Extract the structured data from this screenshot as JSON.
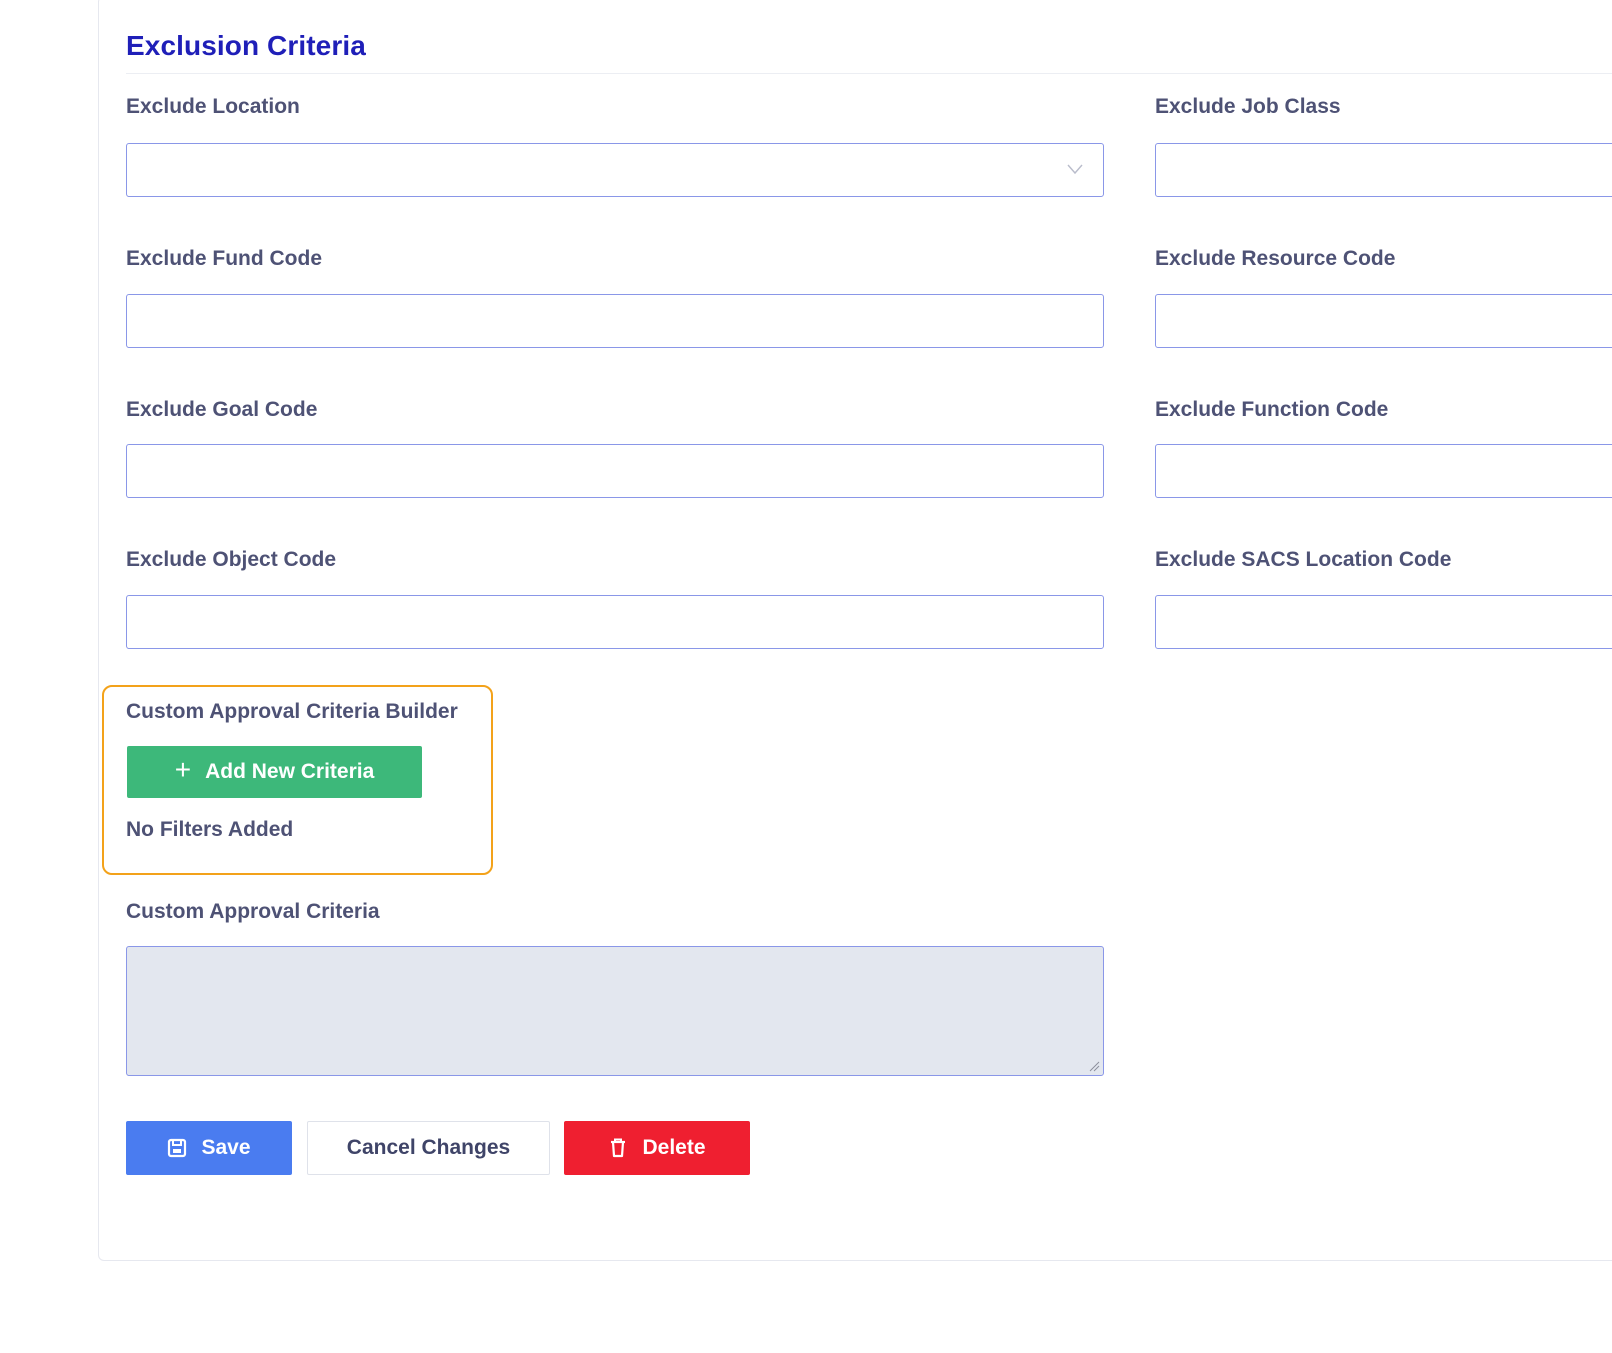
{
  "section": {
    "title": "Exclusion Criteria"
  },
  "fields": {
    "exclude_location": {
      "label": "Exclude Location",
      "value": ""
    },
    "exclude_job_class": {
      "label": "Exclude Job Class",
      "value": ""
    },
    "exclude_fund_code": {
      "label": "Exclude Fund Code",
      "value": ""
    },
    "exclude_resource_code": {
      "label": "Exclude Resource Code",
      "value": ""
    },
    "exclude_goal_code": {
      "label": "Exclude Goal Code",
      "value": ""
    },
    "exclude_function_code": {
      "label": "Exclude Function Code",
      "value": ""
    },
    "exclude_object_code": {
      "label": "Exclude Object Code",
      "value": ""
    },
    "exclude_sacs_location_code": {
      "label": "Exclude SACS Location Code",
      "value": ""
    }
  },
  "builder": {
    "label": "Custom Approval Criteria Builder",
    "add_button_label": "Add New Criteria",
    "add_button_icon": "plus-icon",
    "empty_message": "No Filters Added",
    "highlight_color": "#f3a21a"
  },
  "custom_criteria": {
    "label": "Custom Approval Criteria",
    "value": ""
  },
  "actions": {
    "save_label": "Save",
    "save_icon": "floppy-disk-icon",
    "cancel_label": "Cancel Changes",
    "delete_label": "Delete",
    "delete_icon": "trash-icon"
  },
  "colors": {
    "title": "#1f1fb8",
    "label": "#4e5275",
    "input_border": "#8a97e8",
    "add_button": "#3db87a",
    "save_button": "#4a7cf0",
    "delete_button": "#ef1f30"
  }
}
